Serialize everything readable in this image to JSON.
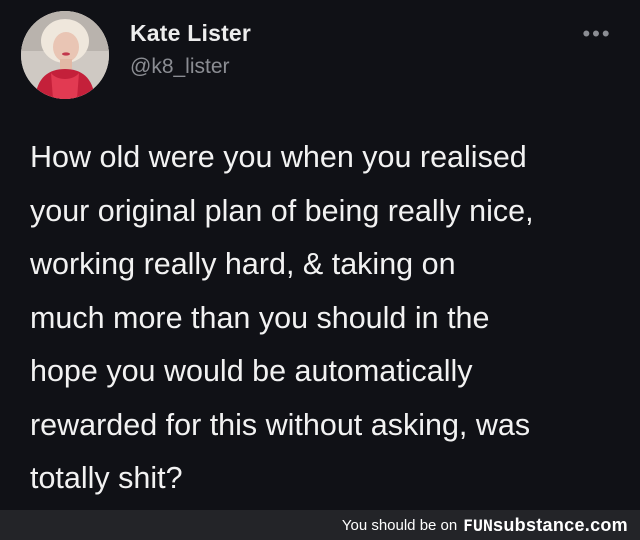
{
  "tweet": {
    "author_name": "Kate Lister",
    "author_handle": "@k8_lister",
    "more_icon": "more-horizontal-icon",
    "more_glyph": "•••",
    "text": "How old were you when you realised\nyour original plan of being really nice,\nworking really hard, & taking on\nmuch more than you should in the\nhope you would be automatically\nrewarded for this without asking, was\ntotally shit?"
  },
  "footer": {
    "prefix": "You should be on",
    "brand_fun": "FUN",
    "brand_rest": "substance.com"
  },
  "colors": {
    "background": "#101116",
    "text_primary": "#f2f2f2",
    "text_secondary": "#8b8d93",
    "footer_background": "#232428"
  }
}
